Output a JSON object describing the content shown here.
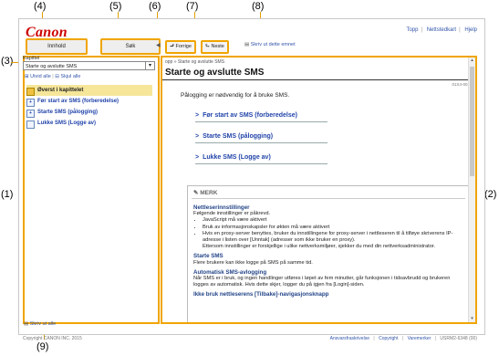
{
  "callouts": {
    "c1": "(1)",
    "c2": "(2)",
    "c3": "(3)",
    "c4": "(4)",
    "c5": "(5)",
    "c6": "(6)",
    "c7": "(7)",
    "c8": "(8)",
    "c9": "(9)"
  },
  "header": {
    "logo": "Canon",
    "links": [
      "Topp",
      "Nettstedkart",
      "Hjelp"
    ]
  },
  "nav": {
    "contents_tab": "Innhold",
    "search_tab": "Søk",
    "prev_label": "Forrige",
    "next_label": "Neste",
    "print_topic": "Skriv ut dette emnet"
  },
  "left": {
    "chapter_label": "Kapittel",
    "chapter_value": "Starte og avslutte SMS",
    "expand_all": "Utvid alle",
    "collapse_all": "Skjul alle",
    "tree": [
      "Øverst i kapittelet",
      "Før start av SMS (forberedelse)",
      "Starte SMS (pålogging)",
      "Lukke SMS (Logge av)"
    ],
    "print_all": "Skriv ut alle"
  },
  "main": {
    "breadcrumb": "opp » Starte og avslutte SMS",
    "title": "Starte og avslutte SMS",
    "code": "01X4-001",
    "intro": "Pålogging er nødvendig for å bruke SMS.",
    "links": [
      "Før start av SMS (forberedelse)",
      "Starte SMS (pålogging)",
      "Lukke SMS (Logge av)"
    ],
    "note": {
      "heading": "MERK",
      "s1_title": "Nettleserinnstillinger",
      "s1_text": "Følgende innstillinger er påkrevd.",
      "s1_b1": "JavaScript må være aktivert",
      "s1_b2": "Bruk av informasjonskapsler for økten må være aktivert",
      "s1_b3": "Hvis en proxy-server benyttes, bruker du innstillingene for proxy-server i nettleseren til å tilføye skriverens IP-adresse i listen over [Unntak] (adresser som ikke bruker en proxy).",
      "s1_b3b": "Ettersom innstillinger er forskjellige i ulike nettverksmiljøer, sjekker du med din nettverksadministrator.",
      "s2_title": "Starte SMS",
      "s2_text": "Flere brukere kan ikke logge på SMS på samme tid.",
      "s3_title": "Automatisk SMS-avlogging",
      "s3_text": "Når SMS er i bruk, og ingen handlinger utføres i løpet av fem minutter, går funksjonen i tidsavbrudd og brukeren logges av automatisk. Hvis dette skjer, logger du på igjen fra [Login]-siden.",
      "s4_title": "Ikke bruk nettleserens [Tilbake]-navigasjonsknapp"
    }
  },
  "footer": {
    "copyright": "Copyright CANON INC. 2015",
    "links": [
      "Ansvarsfraskrivelse",
      "Copyright",
      "Varemerker"
    ],
    "code": "USRM2-6348 (00)"
  },
  "colors": {
    "highlight": "#f0a500",
    "brand": "#cc0000",
    "link": "#2244aa"
  }
}
